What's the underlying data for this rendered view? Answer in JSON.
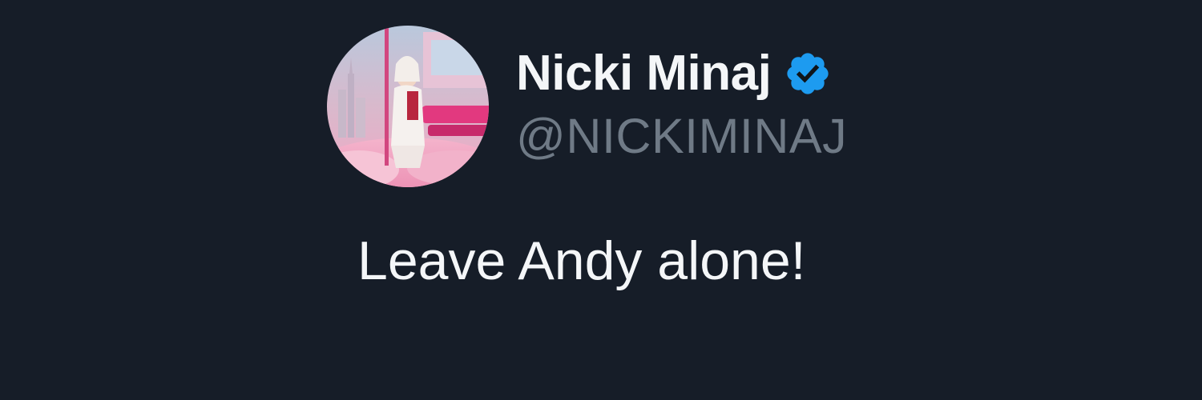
{
  "tweet": {
    "author": {
      "display_name": "Nicki Minaj",
      "handle": "@NICKIMINAJ",
      "verified": true,
      "avatar_icon": "profile-photo-pink-train-interior",
      "verified_icon": "verified-badge-icon"
    },
    "text": "Leave Andy alone!"
  },
  "colors": {
    "background": "#161d28",
    "name_text": "#f4f6f8",
    "handle_text": "#6f7a86",
    "verified_badge": "#1d9bf0"
  }
}
